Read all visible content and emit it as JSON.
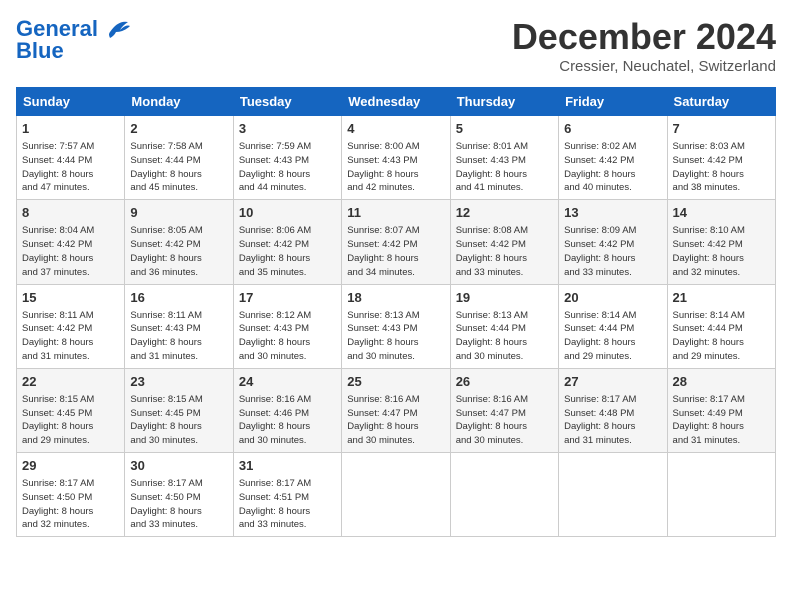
{
  "logo": {
    "line1": "General",
    "line2": "Blue"
  },
  "title": "December 2024",
  "location": "Cressier, Neuchatel, Switzerland",
  "days_of_week": [
    "Sunday",
    "Monday",
    "Tuesday",
    "Wednesday",
    "Thursday",
    "Friday",
    "Saturday"
  ],
  "weeks": [
    [
      {
        "day": "1",
        "info": "Sunrise: 7:57 AM\nSunset: 4:44 PM\nDaylight: 8 hours\nand 47 minutes."
      },
      {
        "day": "2",
        "info": "Sunrise: 7:58 AM\nSunset: 4:44 PM\nDaylight: 8 hours\nand 45 minutes."
      },
      {
        "day": "3",
        "info": "Sunrise: 7:59 AM\nSunset: 4:43 PM\nDaylight: 8 hours\nand 44 minutes."
      },
      {
        "day": "4",
        "info": "Sunrise: 8:00 AM\nSunset: 4:43 PM\nDaylight: 8 hours\nand 42 minutes."
      },
      {
        "day": "5",
        "info": "Sunrise: 8:01 AM\nSunset: 4:43 PM\nDaylight: 8 hours\nand 41 minutes."
      },
      {
        "day": "6",
        "info": "Sunrise: 8:02 AM\nSunset: 4:42 PM\nDaylight: 8 hours\nand 40 minutes."
      },
      {
        "day": "7",
        "info": "Sunrise: 8:03 AM\nSunset: 4:42 PM\nDaylight: 8 hours\nand 38 minutes."
      }
    ],
    [
      {
        "day": "8",
        "info": "Sunrise: 8:04 AM\nSunset: 4:42 PM\nDaylight: 8 hours\nand 37 minutes."
      },
      {
        "day": "9",
        "info": "Sunrise: 8:05 AM\nSunset: 4:42 PM\nDaylight: 8 hours\nand 36 minutes."
      },
      {
        "day": "10",
        "info": "Sunrise: 8:06 AM\nSunset: 4:42 PM\nDaylight: 8 hours\nand 35 minutes."
      },
      {
        "day": "11",
        "info": "Sunrise: 8:07 AM\nSunset: 4:42 PM\nDaylight: 8 hours\nand 34 minutes."
      },
      {
        "day": "12",
        "info": "Sunrise: 8:08 AM\nSunset: 4:42 PM\nDaylight: 8 hours\nand 33 minutes."
      },
      {
        "day": "13",
        "info": "Sunrise: 8:09 AM\nSunset: 4:42 PM\nDaylight: 8 hours\nand 33 minutes."
      },
      {
        "day": "14",
        "info": "Sunrise: 8:10 AM\nSunset: 4:42 PM\nDaylight: 8 hours\nand 32 minutes."
      }
    ],
    [
      {
        "day": "15",
        "info": "Sunrise: 8:11 AM\nSunset: 4:42 PM\nDaylight: 8 hours\nand 31 minutes."
      },
      {
        "day": "16",
        "info": "Sunrise: 8:11 AM\nSunset: 4:43 PM\nDaylight: 8 hours\nand 31 minutes."
      },
      {
        "day": "17",
        "info": "Sunrise: 8:12 AM\nSunset: 4:43 PM\nDaylight: 8 hours\nand 30 minutes."
      },
      {
        "day": "18",
        "info": "Sunrise: 8:13 AM\nSunset: 4:43 PM\nDaylight: 8 hours\nand 30 minutes."
      },
      {
        "day": "19",
        "info": "Sunrise: 8:13 AM\nSunset: 4:44 PM\nDaylight: 8 hours\nand 30 minutes."
      },
      {
        "day": "20",
        "info": "Sunrise: 8:14 AM\nSunset: 4:44 PM\nDaylight: 8 hours\nand 29 minutes."
      },
      {
        "day": "21",
        "info": "Sunrise: 8:14 AM\nSunset: 4:44 PM\nDaylight: 8 hours\nand 29 minutes."
      }
    ],
    [
      {
        "day": "22",
        "info": "Sunrise: 8:15 AM\nSunset: 4:45 PM\nDaylight: 8 hours\nand 29 minutes."
      },
      {
        "day": "23",
        "info": "Sunrise: 8:15 AM\nSunset: 4:45 PM\nDaylight: 8 hours\nand 30 minutes."
      },
      {
        "day": "24",
        "info": "Sunrise: 8:16 AM\nSunset: 4:46 PM\nDaylight: 8 hours\nand 30 minutes."
      },
      {
        "day": "25",
        "info": "Sunrise: 8:16 AM\nSunset: 4:47 PM\nDaylight: 8 hours\nand 30 minutes."
      },
      {
        "day": "26",
        "info": "Sunrise: 8:16 AM\nSunset: 4:47 PM\nDaylight: 8 hours\nand 30 minutes."
      },
      {
        "day": "27",
        "info": "Sunrise: 8:17 AM\nSunset: 4:48 PM\nDaylight: 8 hours\nand 31 minutes."
      },
      {
        "day": "28",
        "info": "Sunrise: 8:17 AM\nSunset: 4:49 PM\nDaylight: 8 hours\nand 31 minutes."
      }
    ],
    [
      {
        "day": "29",
        "info": "Sunrise: 8:17 AM\nSunset: 4:50 PM\nDaylight: 8 hours\nand 32 minutes."
      },
      {
        "day": "30",
        "info": "Sunrise: 8:17 AM\nSunset: 4:50 PM\nDaylight: 8 hours\nand 33 minutes."
      },
      {
        "day": "31",
        "info": "Sunrise: 8:17 AM\nSunset: 4:51 PM\nDaylight: 8 hours\nand 33 minutes."
      },
      {
        "day": "",
        "info": ""
      },
      {
        "day": "",
        "info": ""
      },
      {
        "day": "",
        "info": ""
      },
      {
        "day": "",
        "info": ""
      }
    ]
  ]
}
